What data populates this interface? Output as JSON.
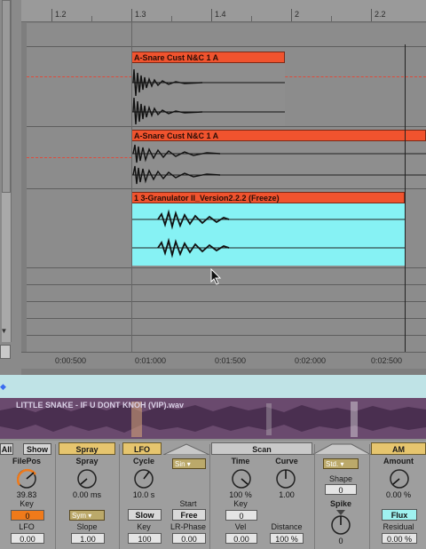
{
  "ruler": {
    "bars": [
      "1.2",
      "1.3",
      "1.4",
      "2",
      "2.2"
    ]
  },
  "clips": [
    {
      "name": "A-Snare Cust N&C 1 A"
    },
    {
      "name": "A-Snare Cust N&C 1 A"
    },
    {
      "name": "1 3-Granulator II_Version2.2.2 (Freeze)"
    }
  ],
  "timeline": {
    "labels": [
      "0:00:500",
      "0:01:000",
      "0:01:500",
      "0:02:000",
      "0:02:500"
    ]
  },
  "sample": {
    "title": "LITTLE SNAKE - IF U DONT KNOH (VIP).wav"
  },
  "device": {
    "tabs": {
      "all": "All",
      "show": "Show"
    },
    "sections": {
      "spray": "Spray",
      "lfo": "LFO",
      "scan": "Scan",
      "am": "AM"
    },
    "filepos": {
      "label": "FilePos",
      "value": "39.83",
      "key_label": "Key",
      "key_value": "0",
      "lfo_label": "LFO",
      "lfo_value": "0.00"
    },
    "spray": {
      "label": "Spray",
      "value": "0.00 ms",
      "mode": "Sym",
      "slope_label": "Slope",
      "slope_value": "1.00"
    },
    "cycle": {
      "label": "Cycle",
      "value": "10.0 s",
      "mode_btn": "Slow",
      "key_label": "Key",
      "key_value": "100"
    },
    "lfo_shape": {
      "dd": "Sin",
      "start_label": "Start",
      "start_btn": "Free",
      "lrphase_label": "LR-Phase",
      "lrphase_value": "0.00"
    },
    "time": {
      "label": "Time",
      "value": "100 %",
      "key_label": "Key",
      "key_value": "0",
      "vel_label": "Vel",
      "vel_value": "0.00"
    },
    "curve": {
      "label": "Curve",
      "value": "1.00",
      "distance_label": "Distance",
      "distance_value": "100 %"
    },
    "window": {
      "dd": "Std.",
      "shape_label": "Shape",
      "shape_value": "0",
      "spike_label": "Spike",
      "spike_value": "0"
    },
    "amount": {
      "label": "Amount",
      "value": "0.00 %",
      "flux_btn": "Flux",
      "residual_label": "Residual",
      "residual_value": "0.00 %"
    }
  },
  "colors": {
    "clip_header": "#f0532e",
    "clip_cyan": "#86f2f4",
    "waveform_bg": "#6a4a6e",
    "knob_active": "#f07a1a"
  }
}
